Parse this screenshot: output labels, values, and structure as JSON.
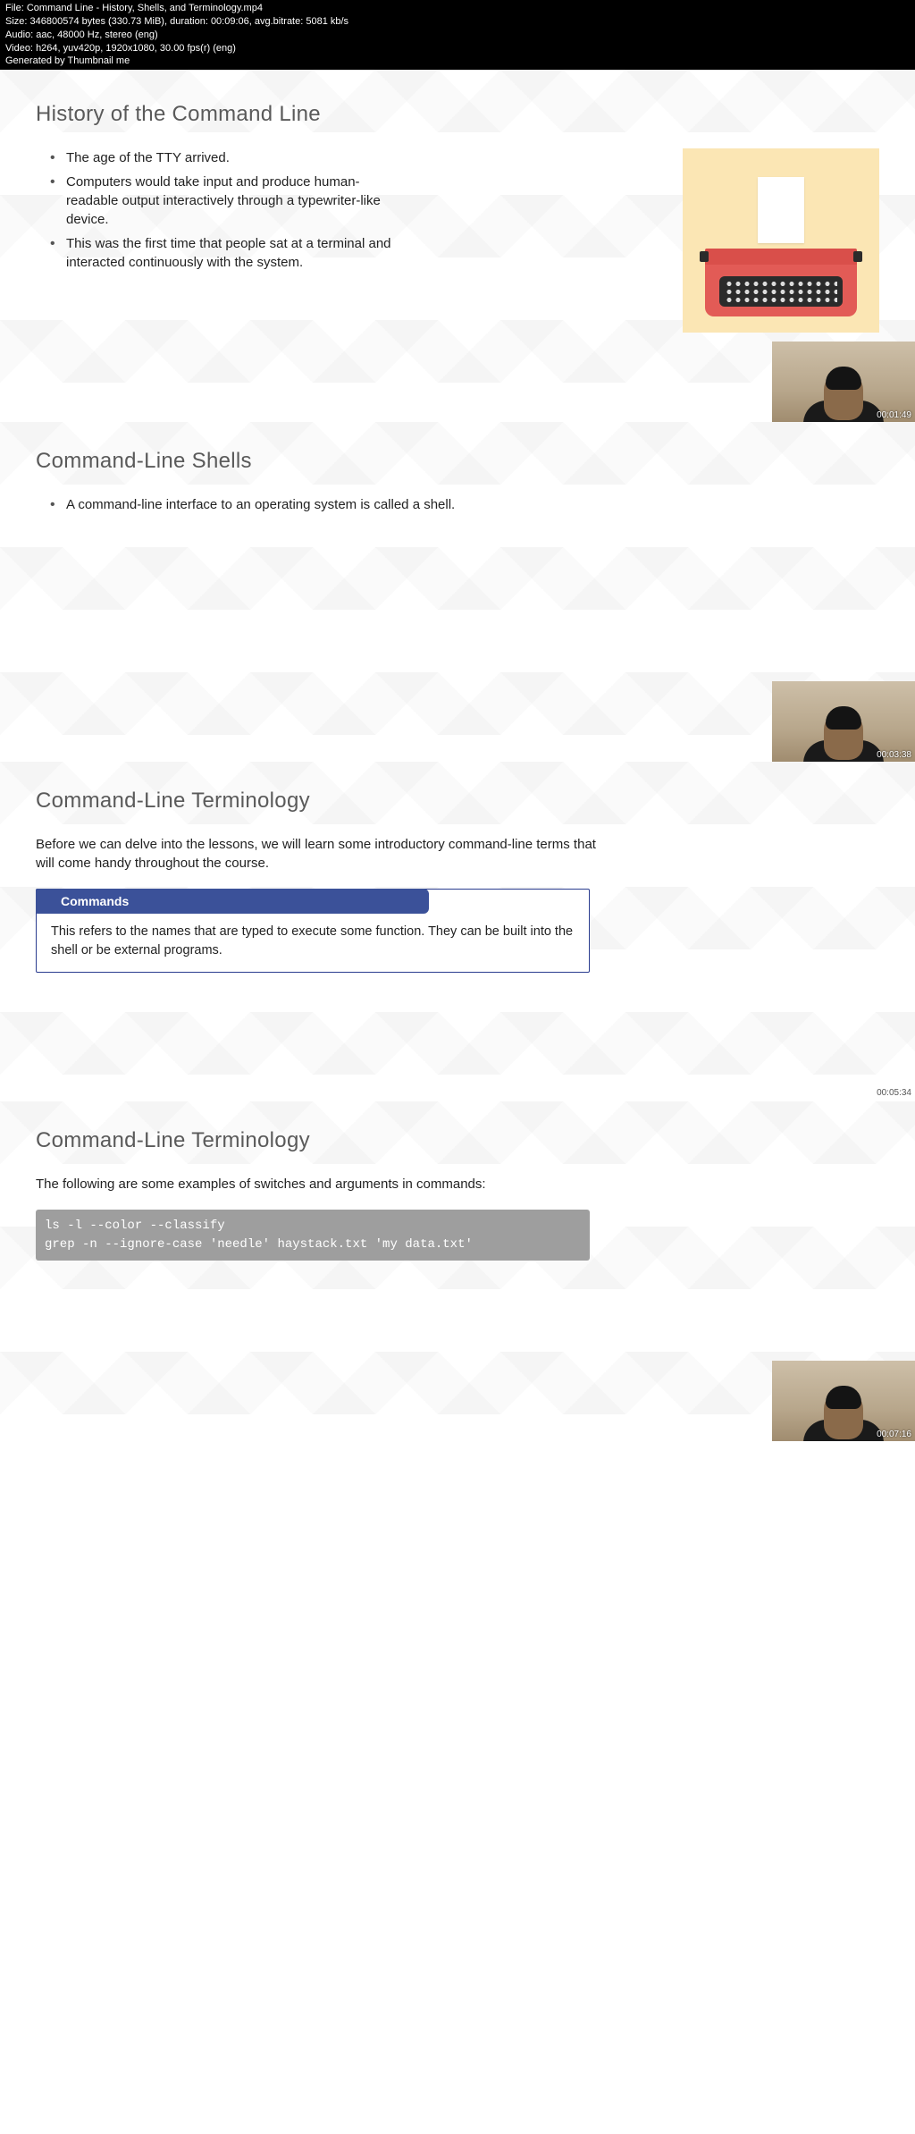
{
  "meta": {
    "file_label": "File:",
    "file": "Command Line - History, Shells, and Terminology.mp4",
    "size_label": "Size:",
    "size": "346800574 bytes (330.73 MiB), duration: 00:09:06, avg.bitrate: 5081 kb/s",
    "audio_label": "Audio:",
    "audio": "aac, 48000 Hz, stereo (eng)",
    "video_label": "Video:",
    "video": "h264, yuv420p, 1920x1080, 30.00 fps(r) (eng)",
    "gen": "Generated by Thumbnail me"
  },
  "slides": [
    {
      "title": "History of the Command Line",
      "bullets": [
        "The age of the TTY arrived.",
        "Computers would take input and produce human-readable output interactively through a typewriter-like device.",
        "This was the first time that people sat at a terminal and interacted continuously with the system."
      ],
      "timestamp": "00:01:49"
    },
    {
      "title": "Command-Line Shells",
      "bullets": [
        "A command-line interface to an operating system is called a shell."
      ],
      "timestamp": "00:03:38"
    },
    {
      "title": "Command-Line Terminology",
      "intro": "Before we can delve into the lessons, we will learn some introductory command-line terms that will come handy throughout the course.",
      "def_label": "Commands",
      "def_body": "This refers to the names that are typed to execute some function. They can be built into the shell or be external programs.",
      "timestamp": "00:05:34"
    },
    {
      "title": "Command-Line Terminology",
      "intro": "The following are some examples of switches and arguments in commands:",
      "code": "ls -l --color --classify\ngrep -n --ignore-case 'needle' haystack.txt 'my data.txt'",
      "timestamp": "00:07:16"
    }
  ]
}
